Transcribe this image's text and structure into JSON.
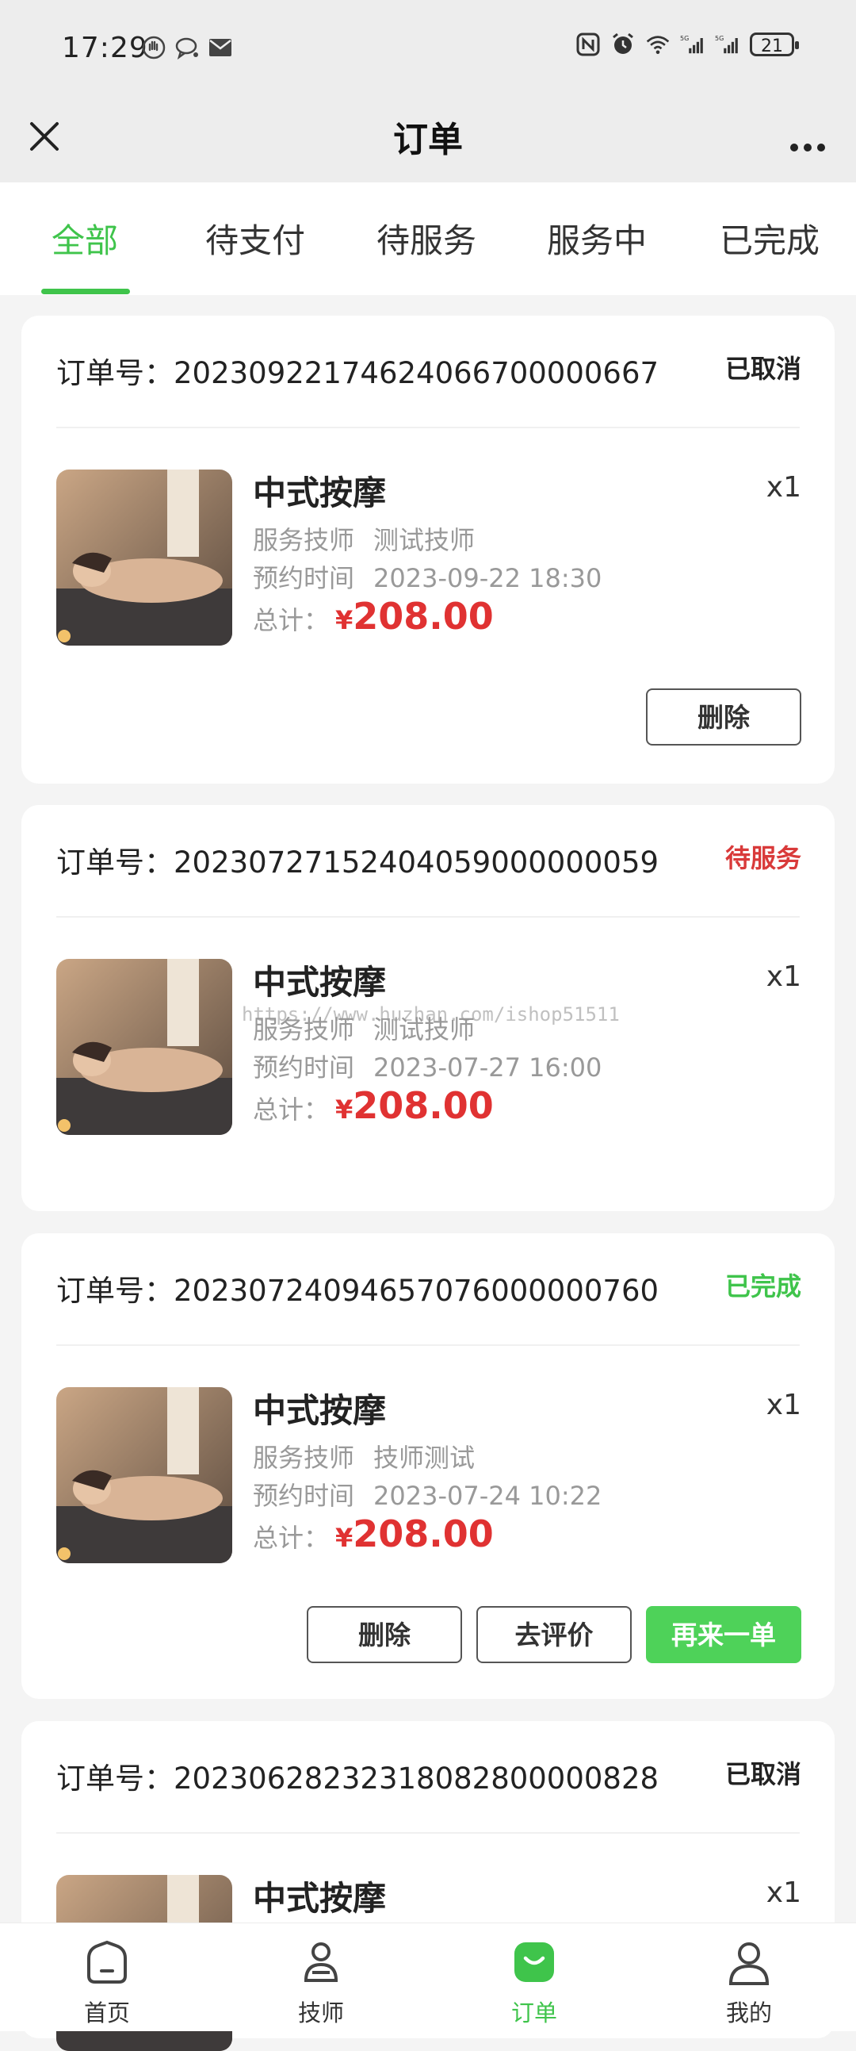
{
  "status_bar": {
    "time": "17:29",
    "battery": "21"
  },
  "header": {
    "title": "订单"
  },
  "tabs": [
    {
      "label": "全部",
      "active": true
    },
    {
      "label": "待支付"
    },
    {
      "label": "待服务"
    },
    {
      "label": "服务中"
    },
    {
      "label": "已完成"
    }
  ],
  "watermark": "https://www.huzhan.com/ishop51511",
  "labels": {
    "order_no": "订单号：",
    "therapist": "服务技师",
    "appointment": "预约时间",
    "total": "总计：",
    "currency": "¥"
  },
  "orders": [
    {
      "order_no": "20230922174624066700000667",
      "status": "已取消",
      "status_color": "#222222",
      "service": "中式按摩",
      "qty": "x1",
      "therapist": "测试技师",
      "time": "2023-09-22 18:30",
      "price": "208.00",
      "buttons": [
        "删除"
      ]
    },
    {
      "order_no": "20230727152404059000000059",
      "status": "待服务",
      "status_color": "#d93a3a",
      "service": "中式按摩",
      "qty": "x1",
      "therapist": "测试技师",
      "time": "2023-07-27 16:00",
      "price": "208.00",
      "buttons": []
    },
    {
      "order_no": "20230724094657076000000760",
      "status": "已完成",
      "status_color": "#3fc44b",
      "service": "中式按摩",
      "qty": "x1",
      "therapist": "技师测试",
      "time": "2023-07-24 10:22",
      "price": "208.00",
      "buttons": [
        "删除",
        "去评价",
        "再来一单"
      ]
    },
    {
      "order_no": "20230628232318082800000828",
      "status": "已取消",
      "status_color": "#222222",
      "service": "中式按摩",
      "qty": "x1"
    }
  ],
  "bottom_nav": [
    {
      "label": "首页",
      "icon": "home-icon"
    },
    {
      "label": "技师",
      "icon": "therapist-icon"
    },
    {
      "label": "订单",
      "icon": "orders-icon",
      "active": true
    },
    {
      "label": "我的",
      "icon": "profile-icon"
    }
  ],
  "colors": {
    "accent": "#3fc44b",
    "price": "#e03232",
    "pending": "#d93a3a"
  }
}
